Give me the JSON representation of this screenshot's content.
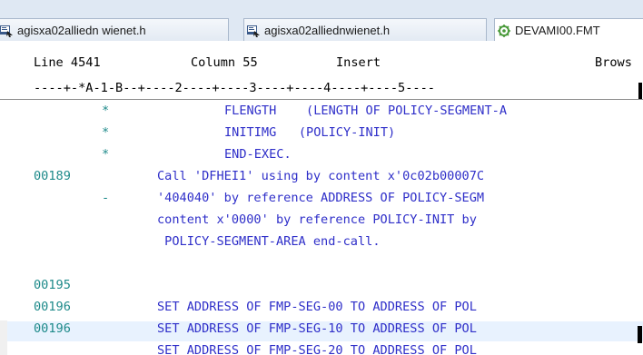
{
  "tabs": [
    {
      "label": "agisxa02alliedn wienet.h",
      "icon": "program-file-icon"
    },
    {
      "label": "agisxa02alliednwienet.h",
      "icon": "program-file-icon"
    },
    {
      "label": "DEVAMI00.FMT",
      "icon": "gear-file-icon"
    }
  ],
  "status": {
    "line": "Line 4541",
    "column": "Column 55",
    "mode": "Insert",
    "extra": "Brows"
  },
  "ruler": "----+-*A-1-B--+----2----+----3----+----4----+----5----",
  "lines": [
    {
      "num": "",
      "mark": "*",
      "code": "FLENGTH    (LENGTH OF POLICY-SEGMENT-A",
      "indent": "deep"
    },
    {
      "num": "",
      "mark": "*",
      "code": "INITIMG   (POLICY-INIT)",
      "indent": "deep"
    },
    {
      "num": "",
      "mark": "*",
      "code": "END-EXEC.",
      "indent": "deep"
    },
    {
      "num": "00189",
      "mark": "",
      "code": "Call 'DFHEI1' using by content x'0c02b00007C",
      "indent": "normal"
    },
    {
      "num": "",
      "mark": "-",
      "code": "'404040' by reference ADDRESS OF POLICY-SEGM",
      "indent": "normal"
    },
    {
      "num": "",
      "mark": "",
      "code": "content x'0000' by reference POLICY-INIT by",
      "indent": "normal"
    },
    {
      "num": "",
      "mark": "",
      "code": " POLICY-SEGMENT-AREA end-call.",
      "indent": "normal"
    },
    {
      "num": "",
      "mark": "",
      "code": "",
      "indent": "normal"
    },
    {
      "num": "00195",
      "mark": "",
      "code": "",
      "indent": "normal"
    },
    {
      "num": "00196",
      "mark": "",
      "code": "SET ADDRESS OF FMP-SEG-00 TO ADDRESS OF POL",
      "indent": "normal"
    },
    {
      "num": "00196",
      "mark": "",
      "code": "SET ADDRESS OF FMP-SEG-10 TO ADDRESS OF POL",
      "indent": "normal",
      "highlight": true
    },
    {
      "num": "",
      "mark": "",
      "code": "SET ADDRESS OF FMP-SEG-20 TO ADDRESS OF POL",
      "indent": "normal"
    }
  ],
  "colors": {
    "line_number": "#1e8a8a",
    "code_text": "#2f2fc9",
    "highlight": "#e8f2fe",
    "tab_bar": "#dfe8f3"
  }
}
